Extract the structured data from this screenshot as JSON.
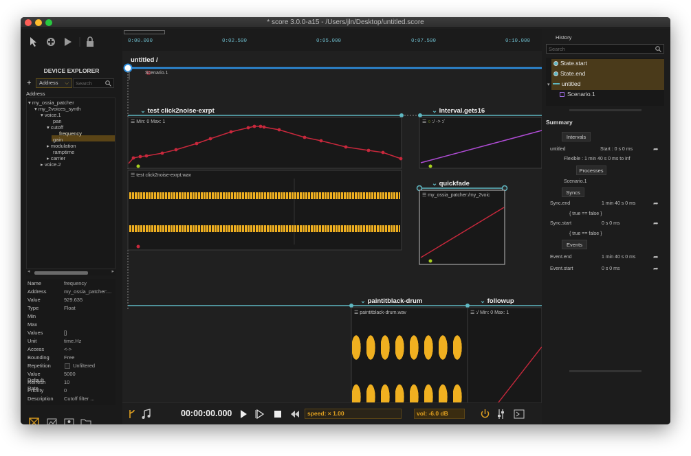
{
  "window": {
    "title": "* score 3.0.0-a15 - /Users/jln/Desktop/untitled.score"
  },
  "device_explorer": {
    "heading": "DEVICE EXPLORER",
    "add_label": "+",
    "filter_select": "Address",
    "search_placeholder": "Search",
    "column_header": "Address",
    "tree": [
      {
        "label": "my_ossia_patcher",
        "arrow": "▾"
      },
      {
        "label": "my_2voices_synth",
        "arrow": "▾"
      },
      {
        "label": "voice.1",
        "arrow": "▾"
      },
      {
        "label": "pan",
        "arrow": ""
      },
      {
        "label": "cutoff",
        "arrow": "▾"
      },
      {
        "label": "frequency",
        "arrow": ""
      },
      {
        "label": "gain",
        "arrow": ""
      },
      {
        "label": "modulation",
        "arrow": "▸"
      },
      {
        "label": "ramptime",
        "arrow": ""
      },
      {
        "label": "carrier",
        "arrow": "▸"
      },
      {
        "label": "voice.2",
        "arrow": "▸"
      }
    ],
    "properties": [
      {
        "key": "Name",
        "value": "frequency"
      },
      {
        "key": "Address",
        "value": "my_ossia_patcher:..."
      },
      {
        "key": "Value",
        "value": "929.635"
      },
      {
        "key": "Type",
        "value": "Float"
      },
      {
        "key": "Min",
        "value": ""
      },
      {
        "key": "Max",
        "value": ""
      },
      {
        "key": "Values",
        "value": "[]"
      },
      {
        "key": "Unit",
        "value": "time.Hz"
      },
      {
        "key": "Access",
        "value": "<->"
      },
      {
        "key": "Bounding",
        "value": "Free"
      },
      {
        "key": "Repetition",
        "value": "Unfiltered"
      },
      {
        "key": "Value Default",
        "value": "5000"
      },
      {
        "key": "Refresh Rate",
        "value": "10"
      },
      {
        "key": "Priority",
        "value": "0"
      },
      {
        "key": "Description",
        "value": "Cutoff filter ..."
      }
    ]
  },
  "timeline": {
    "ruler": [
      "0:00.000",
      "0:02.500",
      "0:05.000",
      "0:07.500",
      "0:10.000"
    ],
    "scenario_title": "untitled /",
    "scenario_name": "Scenario.1",
    "intervals": {
      "click": "test click2noise-exrpt",
      "interval16": "Interval.gets16",
      "quickfade": "quickfade",
      "painit": "paintitblack-drum",
      "followup": "followup"
    },
    "automation_minmax": "Min: 0  Max: 1",
    "audio_file": "test click2noise-exrpt.wav",
    "interval16_process": ":/ -> :/",
    "quickfade_process": "my_ossia_patcher:/my_2voic",
    "painit_file": "paintitblack-drum.wav",
    "followup_process": ":/  Min: 0  Max: 1"
  },
  "transport": {
    "time": "00:00:00.000",
    "speed": "speed: × 1.00",
    "vol": "vol: -6.0 dB"
  },
  "history": {
    "heading": "History",
    "search_placeholder": "Search",
    "items": [
      {
        "label": "State.start"
      },
      {
        "label": "State.end"
      },
      {
        "label": "untitled"
      },
      {
        "label": "Scenario.1"
      }
    ]
  },
  "summary": {
    "heading": "Summary",
    "intervals_btn": "Intervals",
    "interval_name": "untitled",
    "interval_start": "Start : 0 s 0 ms",
    "interval_flexible": "Flexible : 1 min 40 s 0 ms to inf",
    "processes_btn": "Processes",
    "process_name": "Scenario.1",
    "syncs_btn": "Syncs",
    "sync_end_name": "Sync.end",
    "sync_end_time": "1 min 40 s 0 ms",
    "sync_end_cond": "{ true == false }",
    "sync_start_name": "Sync.start",
    "sync_start_time": "0 s 0 ms",
    "sync_start_cond": "{ true == false }",
    "events_btn": "Events",
    "event_end_name": "Event.end",
    "event_end_time": "1 min 40 s 0 ms",
    "event_start_name": "Event.start",
    "event_start_time": "0 s 0 ms"
  },
  "colors": {
    "accent_blue": "#2d8fe0",
    "interval_teal": "#5fb8c2",
    "curve_red": "#c8283c",
    "wave_yellow": "#f0b020",
    "purple": "#b04cd6",
    "history_bg": "#4a3a1a"
  }
}
